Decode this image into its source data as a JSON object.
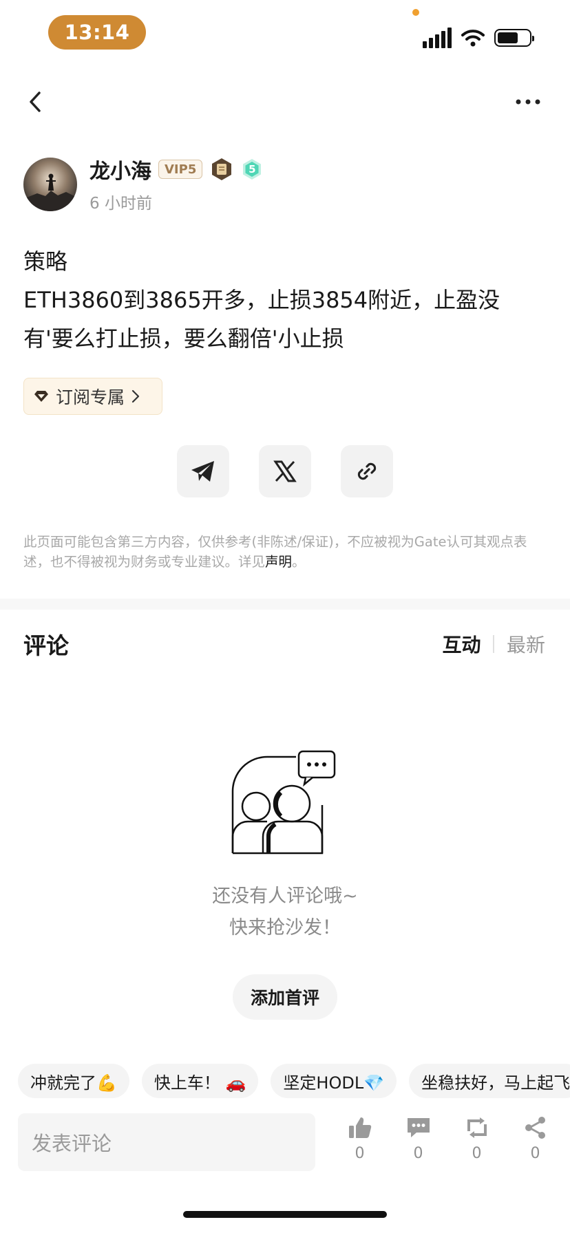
{
  "status_bar": {
    "time": "13:14"
  },
  "author": {
    "name": "龙小海",
    "vip": "VIP5",
    "level": "5",
    "time_ago": "6 小时前"
  },
  "post": {
    "lines": [
      "策略",
      "ETH3860到3865开多，止损3854附近，止盈没",
      "有'要么打止损，要么翻倍'小止损"
    ]
  },
  "subscribe": {
    "label": "订阅专属"
  },
  "disclaimer": {
    "text": "此页面可能包含第三方内容，仅供参考(非陈述/保证)，不应被视为Gate认可其观点表述，也不得被视为财务或专业建议。详见",
    "link": "声明",
    "end": "。"
  },
  "comments": {
    "title": "评论",
    "sort_active": "互动",
    "sort_other": "最新",
    "empty_line1": "还没有人评论哦~",
    "empty_line2": "快来抢沙发！",
    "add_first": "添加首评"
  },
  "quick_replies": [
    "冲就完了💪",
    "快上车！ 🚗",
    "坚定HODL💎",
    "坐稳扶好，马上起飞"
  ],
  "bottom_bar": {
    "input_placeholder": "发表评论",
    "like_count": "0",
    "comment_count": "0",
    "repost_count": "0",
    "share_count": "0"
  },
  "colors": {
    "accent": "#cf8a33",
    "level_badge": "#4fd6b5"
  },
  "icons": [
    "back-icon",
    "more-icon",
    "telegram-icon",
    "x-icon",
    "link-icon",
    "like-icon",
    "comment-icon",
    "repost-icon",
    "share-icon"
  ]
}
